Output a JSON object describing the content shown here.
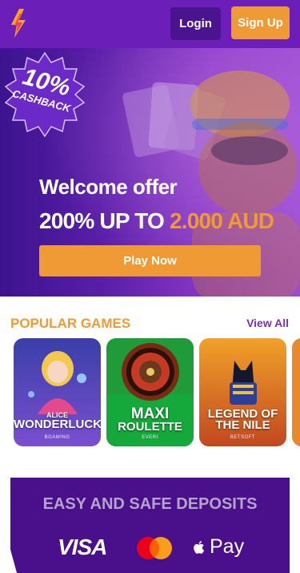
{
  "header": {
    "login_label": "Login",
    "signup_label": "Sign Up"
  },
  "hero": {
    "badge_percent": "10%",
    "badge_label": "CASHBACK",
    "title": "Welcome offer",
    "offer_prefix": "200% UP TO",
    "offer_amount": "2.000 AUD",
    "play_label": "Play Now"
  },
  "popular": {
    "title": "POPULAR GAMES",
    "view_all": "View All",
    "games": [
      {
        "name_line1": "ALICE",
        "name_line2": "WONDERLUCK",
        "provider": "BGAMING"
      },
      {
        "name_line1": "MAXI",
        "name_line2": "ROULETTE",
        "provider": "EVERI"
      },
      {
        "name_line1": "LEGEND OF",
        "name_line2": "THE NILE",
        "provider": "BETSOFT"
      }
    ]
  },
  "deposits": {
    "title": "EASY AND SAFE DEPOSITS",
    "visa": "VISA",
    "applepay": "Pay"
  },
  "colors": {
    "brand_purple": "#6b1fb8",
    "accent_orange": "#ef9a34",
    "deposit_bg": "#4a0f8a"
  }
}
